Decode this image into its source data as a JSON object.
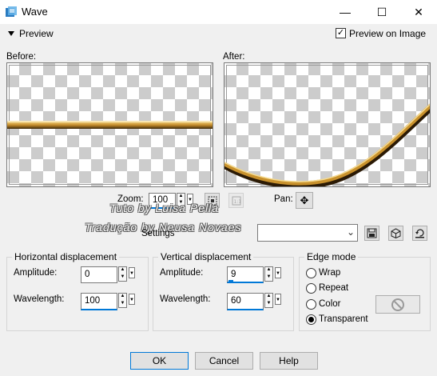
{
  "window": {
    "title": "Wave",
    "minimize_glyph": "—",
    "maximize_glyph": "☐",
    "close_glyph": "✕"
  },
  "preview_section": {
    "label": "Preview",
    "preview_on_image_label": "Preview on Image",
    "preview_on_image_checked": true
  },
  "panes": {
    "before_label": "Before:",
    "after_label": "After:"
  },
  "zoom": {
    "label": "Zoom:",
    "value": "100"
  },
  "pan": {
    "label": "Pan:"
  },
  "watermark": {
    "line1": "Tuto by Luisa Pella",
    "line2": "Tradução by Neusa Novaes"
  },
  "settings": {
    "label": "Settings",
    "value": ""
  },
  "horizontal": {
    "title": "Horizontal displacement",
    "amplitude_label": "Amplitude:",
    "amplitude_value": "0",
    "wavelength_label": "Wavelength:",
    "wavelength_value": "100"
  },
  "vertical": {
    "title": "Vertical displacement",
    "amplitude_label": "Amplitude:",
    "amplitude_value": "9",
    "wavelength_label": "Wavelength:",
    "wavelength_value": "60"
  },
  "edge_mode": {
    "title": "Edge mode",
    "options": [
      "Wrap",
      "Repeat",
      "Color",
      "Transparent"
    ],
    "selected": "Transparent"
  },
  "buttons": {
    "ok": "OK",
    "cancel": "Cancel",
    "help": "Help"
  }
}
